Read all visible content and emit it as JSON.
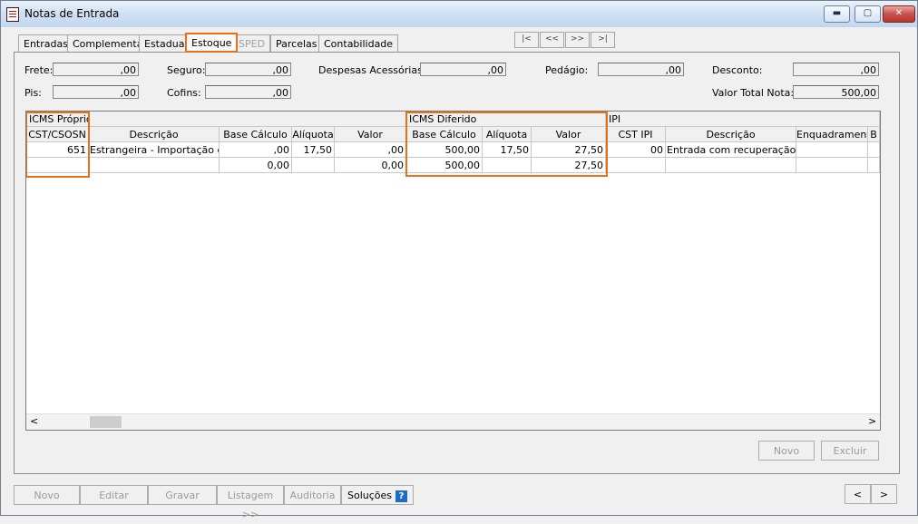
{
  "window": {
    "title": "Notas de Entrada",
    "controls": {
      "minimize": "▬",
      "maximize": "▢",
      "close": "✕"
    }
  },
  "tabs": [
    {
      "label": "Entradas",
      "state": "normal"
    },
    {
      "label": "Complementar",
      "state": "normal"
    },
    {
      "label": "Estadual",
      "state": "normal"
    },
    {
      "label": "Estoque",
      "state": "active"
    },
    {
      "label": "SPED",
      "state": "disabled"
    },
    {
      "label": "Parcelas",
      "state": "normal"
    },
    {
      "label": "Contabilidade",
      "state": "normal"
    }
  ],
  "record_nav": {
    "first": "|<",
    "prev": "<<",
    "next": ">>",
    "last": ">|"
  },
  "fields": {
    "frete": {
      "label": "Frete:",
      "value": ",00"
    },
    "seguro": {
      "label": "Seguro:",
      "value": ",00"
    },
    "despesas": {
      "label": "Despesas Acessórias:",
      "value": ",00"
    },
    "pedagio": {
      "label": "Pedágio:",
      "value": ",00"
    },
    "desconto": {
      "label": "Desconto:",
      "value": ",00"
    },
    "pis": {
      "label": "Pis:",
      "value": ",00"
    },
    "cofins": {
      "label": "Cofins:",
      "value": ",00"
    },
    "valor_total": {
      "label": "Valor Total Nota:",
      "value": "500,00"
    }
  },
  "grid": {
    "groups": {
      "icms_proprio": "ICMS Próprio",
      "icms_diferido": "ICMS Diferido",
      "ipi": "IPI"
    },
    "columns": [
      "CST/CSOSN",
      "Descrição",
      "Base Cálculo",
      "Alíquota",
      "Valor",
      "Base Cálculo",
      "Alíquota",
      "Valor",
      "CST IPI",
      "Descrição",
      "Enquadramento",
      "B"
    ],
    "rows": [
      [
        "651",
        "Estrangeira - Importação direta",
        ",00",
        "17,50",
        ",00",
        "500,00",
        "17,50",
        "27,50",
        "00",
        "Entrada com recuperação de",
        "",
        ""
      ]
    ],
    "totals": [
      "",
      "",
      "0,00",
      "",
      "0,00",
      "500,00",
      "",
      "27,50",
      "",
      "",
      "",
      ""
    ],
    "scroll": {
      "left": "<",
      "right": ">"
    }
  },
  "panel_buttons": {
    "novo": "Novo",
    "excluir": "Excluir"
  },
  "footer": {
    "novo": "Novo",
    "editar": "Editar",
    "gravar": "Gravar",
    "listagem": "Listagem >>",
    "auditoria": "Auditoria",
    "solucoes": "Soluções",
    "help": "?",
    "prev": "<",
    "next": ">"
  },
  "colors": {
    "highlight": "#e8701a"
  }
}
